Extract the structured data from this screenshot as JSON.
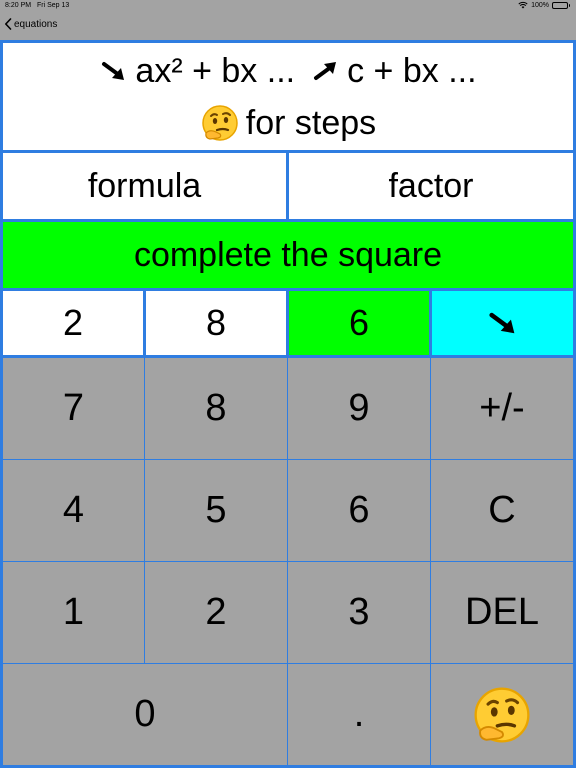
{
  "status": {
    "time": "8:20 PM",
    "date": "Fri Sep 13",
    "battery": "100%",
    "battery_level": 1.0,
    "icons": [
      "wifi-icon",
      "battery-icon"
    ]
  },
  "nav": {
    "back_label": "equations",
    "back_icon": "chevron-left-icon"
  },
  "info": {
    "line1_left": "ax² + bx ...",
    "line1_right": "c + bx ...",
    "line2_text": "for steps",
    "icons": [
      "arrow-down-right-icon",
      "arrow-up-right-icon",
      "thinking-face-icon"
    ]
  },
  "methods": {
    "formula": "formula",
    "factor": "factor",
    "complete": "complete the square",
    "selected": "complete the square",
    "selected_color": "#00ff00"
  },
  "coefficients": {
    "a": "2",
    "b": "8",
    "c": "6",
    "active": "c",
    "active_color": "#00ff00",
    "direction_icon": "arrow-down-right-icon",
    "direction_color": "#00ffff"
  },
  "keypad": {
    "k7": "7",
    "k8": "8",
    "k9": "9",
    "sign": "+/-",
    "k4": "4",
    "k5": "5",
    "k6": "6",
    "clear": "C",
    "k1": "1",
    "k2": "2",
    "k3": "3",
    "del": "DEL",
    "k0": "0",
    "dot": ".",
    "steps_icon": "thinking-face-icon"
  },
  "colors": {
    "frame": "#2f7de1",
    "key": "#a3a3a3",
    "bar": "#a3a3a3"
  }
}
